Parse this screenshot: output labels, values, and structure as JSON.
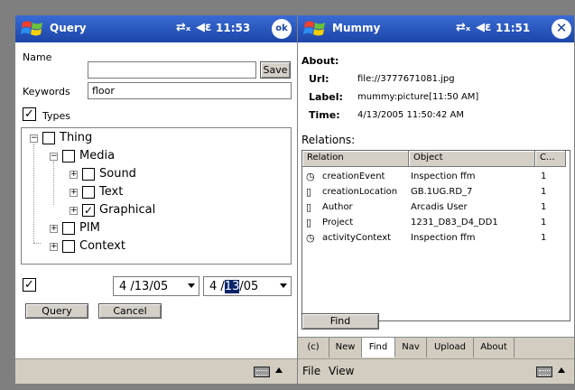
{
  "left": {
    "title": "Query",
    "time": "11:53",
    "ok_label": "ok",
    "name_label": "Name",
    "name_value": "",
    "save_label": "Save",
    "keywords_label": "Keywords",
    "keywords_value": "floor",
    "types_label": "Types",
    "types_checked": true,
    "tree": [
      {
        "label": "Thing",
        "checked": false
      },
      {
        "label": "Media",
        "checked": false
      },
      {
        "label": "Sound",
        "checked": false
      },
      {
        "label": "Text",
        "checked": false
      },
      {
        "label": "Graphical",
        "checked": true
      },
      {
        "label": "PIM",
        "checked": false
      },
      {
        "label": "Context",
        "checked": false
      }
    ],
    "date_checked": true,
    "date_from": "4 /13/05",
    "date_to_pre": "4 /",
    "date_to_sel": "13",
    "date_to_post": "/05",
    "query_label": "Query",
    "cancel_label": "Cancel"
  },
  "right": {
    "title": "Mummy",
    "time": "11:51",
    "about_label": "About:",
    "url_label": "Url:",
    "url_value": "file://3777671081.jpg",
    "label_label": "Label:",
    "label_value": "mummy:picture[11:50 AM]",
    "time_label": "Time:",
    "time_value": "4/13/2005 11:50:42 AM",
    "relations_label": "Relations:",
    "columns": [
      "Relation",
      "Object",
      "C..."
    ],
    "rows": [
      {
        "icon": "clock-icon",
        "relation": "creationEvent",
        "object": "Inspection ffm",
        "count": "1"
      },
      {
        "icon": "doc-icon",
        "relation": "creationLocation",
        "object": "GB.1UG.RD_7",
        "count": "1"
      },
      {
        "icon": "doc-icon",
        "relation": "Author",
        "object": "Arcadis User",
        "count": "1"
      },
      {
        "icon": "doc-icon",
        "relation": "Project",
        "object": "1231_D83_D4_DD1",
        "count": "1"
      },
      {
        "icon": "clock-icon",
        "relation": "activityContext",
        "object": "Inspection ffm",
        "count": "1"
      }
    ],
    "find_label": "Find",
    "tabs": [
      "(c)",
      "New",
      "Find",
      "Nav",
      "Upload",
      "About"
    ],
    "active_tab": "Find",
    "menu_file": "File",
    "menu_view": "View"
  },
  "colors": {
    "titlebar": "#1c45a8",
    "selection": "#0a246a",
    "command_bar": "#d3cdc1",
    "frame": "#7f7f7f"
  }
}
